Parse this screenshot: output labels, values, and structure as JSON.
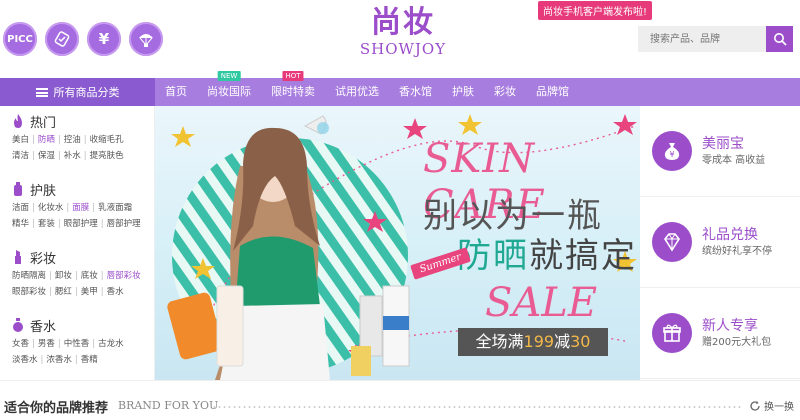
{
  "header": {
    "service_icons": [
      {
        "name": "picc",
        "label": "PICC"
      },
      {
        "name": "authentic-guarantee",
        "label": ""
      },
      {
        "name": "yen-icon",
        "label": "¥"
      },
      {
        "name": "parachute-icon",
        "label": ""
      }
    ],
    "logo_cn": "尚妆",
    "logo_en": "SHOWJOY",
    "app_promo": "尚妆手机客户端发布啦!",
    "search_placeholder": "搜索产品、品牌"
  },
  "nav": {
    "all_categories": "所有商品分类",
    "items": [
      {
        "label": "首页",
        "badge": ""
      },
      {
        "label": "尚妆国际",
        "badge": "NEW"
      },
      {
        "label": "限时特卖",
        "badge": "HOT"
      },
      {
        "label": "试用优选",
        "badge": ""
      },
      {
        "label": "香水馆",
        "badge": ""
      },
      {
        "label": "护肤",
        "badge": ""
      },
      {
        "label": "彩妆",
        "badge": ""
      },
      {
        "label": "品牌馆",
        "badge": ""
      }
    ]
  },
  "sidebar": {
    "categories": [
      {
        "title": "热门",
        "icon": "flame-icon",
        "lines": [
          [
            "美白",
            "防晒",
            "控油",
            "收缩毛孔"
          ],
          [
            "清洁",
            "保湿",
            "补水",
            "提亮肤色"
          ]
        ],
        "highlight": [
          "防晒"
        ]
      },
      {
        "title": "护肤",
        "icon": "bottle-icon",
        "lines": [
          [
            "洁面",
            "化妆水",
            "面膜",
            "乳液面霜"
          ],
          [
            "精华",
            "套装",
            "眼部护理",
            "唇部护理"
          ]
        ],
        "highlight": [
          "面膜"
        ]
      },
      {
        "title": "彩妆",
        "icon": "lipstick-icon",
        "lines": [
          [
            "防晒隔离",
            "卸妆",
            "底妆",
            "唇部彩妆"
          ],
          [
            "眼部彩妆",
            "腮红",
            "美甲",
            "香水"
          ]
        ],
        "highlight": [
          "唇部彩妆"
        ]
      },
      {
        "title": "香水",
        "icon": "perfume-icon",
        "lines": [
          [
            "女香",
            "男香",
            "中性香",
            "古龙水"
          ],
          [
            "淡香水",
            "浓香水",
            "香精"
          ]
        ],
        "highlight": []
      }
    ]
  },
  "banner": {
    "headline_en": "SKIN CARE",
    "headline_cn1": "别以为一瓶",
    "headline_cn2a": "防晒",
    "headline_cn2b": "就搞定",
    "sale": "SALE",
    "summer_tag": "Summer",
    "promo_prefix": "全场满",
    "promo_n1": "199",
    "promo_mid": "减",
    "promo_n2": "30"
  },
  "right_panel": [
    {
      "title": "美丽宝",
      "subtitle": "零成本 高收益",
      "icon": "money-bag-icon"
    },
    {
      "title": "礼品兑换",
      "subtitle": "缤纷好礼享不停",
      "icon": "diamond-icon"
    },
    {
      "title": "新人专享",
      "subtitle": "赠200元大礼包",
      "icon": "gift-icon"
    }
  ],
  "bottom": {
    "title": "适合你的品牌推荐",
    "title_en": "BRAND FOR YOU",
    "refresh": "换一换"
  },
  "colors": {
    "primary": "#9b4dca",
    "nav": "#a77ddf",
    "accent_pink": "#e85c93",
    "accent_green": "#1fa892"
  }
}
